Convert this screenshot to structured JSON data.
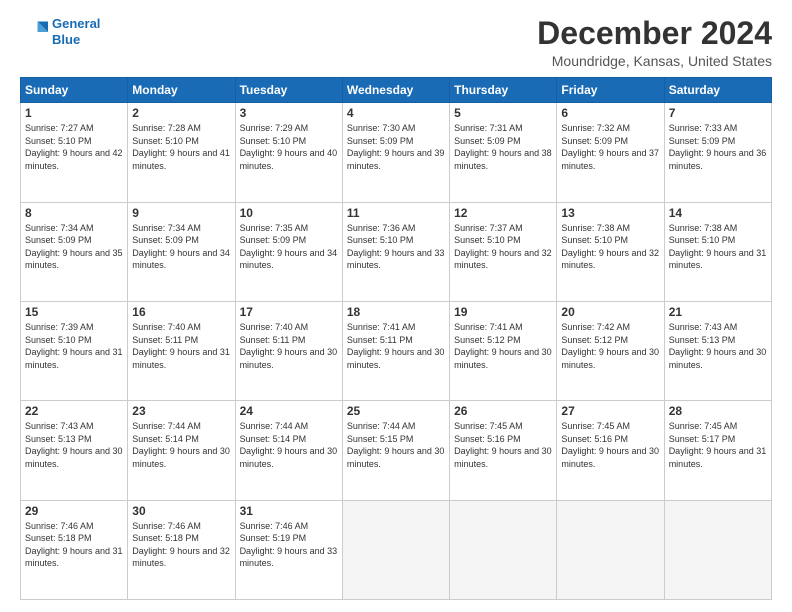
{
  "header": {
    "logo_line1": "General",
    "logo_line2": "Blue",
    "month_title": "December 2024",
    "location": "Moundridge, Kansas, United States"
  },
  "weekdays": [
    "Sunday",
    "Monday",
    "Tuesday",
    "Wednesday",
    "Thursday",
    "Friday",
    "Saturday"
  ],
  "weeks": [
    [
      {
        "day": "1",
        "sunrise": "7:27 AM",
        "sunset": "5:10 PM",
        "daylight": "9 hours and 42 minutes."
      },
      {
        "day": "2",
        "sunrise": "7:28 AM",
        "sunset": "5:10 PM",
        "daylight": "9 hours and 41 minutes."
      },
      {
        "day": "3",
        "sunrise": "7:29 AM",
        "sunset": "5:10 PM",
        "daylight": "9 hours and 40 minutes."
      },
      {
        "day": "4",
        "sunrise": "7:30 AM",
        "sunset": "5:09 PM",
        "daylight": "9 hours and 39 minutes."
      },
      {
        "day": "5",
        "sunrise": "7:31 AM",
        "sunset": "5:09 PM",
        "daylight": "9 hours and 38 minutes."
      },
      {
        "day": "6",
        "sunrise": "7:32 AM",
        "sunset": "5:09 PM",
        "daylight": "9 hours and 37 minutes."
      },
      {
        "day": "7",
        "sunrise": "7:33 AM",
        "sunset": "5:09 PM",
        "daylight": "9 hours and 36 minutes."
      }
    ],
    [
      {
        "day": "8",
        "sunrise": "7:34 AM",
        "sunset": "5:09 PM",
        "daylight": "9 hours and 35 minutes."
      },
      {
        "day": "9",
        "sunrise": "7:34 AM",
        "sunset": "5:09 PM",
        "daylight": "9 hours and 34 minutes."
      },
      {
        "day": "10",
        "sunrise": "7:35 AM",
        "sunset": "5:09 PM",
        "daylight": "9 hours and 34 minutes."
      },
      {
        "day": "11",
        "sunrise": "7:36 AM",
        "sunset": "5:10 PM",
        "daylight": "9 hours and 33 minutes."
      },
      {
        "day": "12",
        "sunrise": "7:37 AM",
        "sunset": "5:10 PM",
        "daylight": "9 hours and 32 minutes."
      },
      {
        "day": "13",
        "sunrise": "7:38 AM",
        "sunset": "5:10 PM",
        "daylight": "9 hours and 32 minutes."
      },
      {
        "day": "14",
        "sunrise": "7:38 AM",
        "sunset": "5:10 PM",
        "daylight": "9 hours and 31 minutes."
      }
    ],
    [
      {
        "day": "15",
        "sunrise": "7:39 AM",
        "sunset": "5:10 PM",
        "daylight": "9 hours and 31 minutes."
      },
      {
        "day": "16",
        "sunrise": "7:40 AM",
        "sunset": "5:11 PM",
        "daylight": "9 hours and 31 minutes."
      },
      {
        "day": "17",
        "sunrise": "7:40 AM",
        "sunset": "5:11 PM",
        "daylight": "9 hours and 30 minutes."
      },
      {
        "day": "18",
        "sunrise": "7:41 AM",
        "sunset": "5:11 PM",
        "daylight": "9 hours and 30 minutes."
      },
      {
        "day": "19",
        "sunrise": "7:41 AM",
        "sunset": "5:12 PM",
        "daylight": "9 hours and 30 minutes."
      },
      {
        "day": "20",
        "sunrise": "7:42 AM",
        "sunset": "5:12 PM",
        "daylight": "9 hours and 30 minutes."
      },
      {
        "day": "21",
        "sunrise": "7:43 AM",
        "sunset": "5:13 PM",
        "daylight": "9 hours and 30 minutes."
      }
    ],
    [
      {
        "day": "22",
        "sunrise": "7:43 AM",
        "sunset": "5:13 PM",
        "daylight": "9 hours and 30 minutes."
      },
      {
        "day": "23",
        "sunrise": "7:44 AM",
        "sunset": "5:14 PM",
        "daylight": "9 hours and 30 minutes."
      },
      {
        "day": "24",
        "sunrise": "7:44 AM",
        "sunset": "5:14 PM",
        "daylight": "9 hours and 30 minutes."
      },
      {
        "day": "25",
        "sunrise": "7:44 AM",
        "sunset": "5:15 PM",
        "daylight": "9 hours and 30 minutes."
      },
      {
        "day": "26",
        "sunrise": "7:45 AM",
        "sunset": "5:16 PM",
        "daylight": "9 hours and 30 minutes."
      },
      {
        "day": "27",
        "sunrise": "7:45 AM",
        "sunset": "5:16 PM",
        "daylight": "9 hours and 30 minutes."
      },
      {
        "day": "28",
        "sunrise": "7:45 AM",
        "sunset": "5:17 PM",
        "daylight": "9 hours and 31 minutes."
      }
    ],
    [
      {
        "day": "29",
        "sunrise": "7:46 AM",
        "sunset": "5:18 PM",
        "daylight": "9 hours and 31 minutes."
      },
      {
        "day": "30",
        "sunrise": "7:46 AM",
        "sunset": "5:18 PM",
        "daylight": "9 hours and 32 minutes."
      },
      {
        "day": "31",
        "sunrise": "7:46 AM",
        "sunset": "5:19 PM",
        "daylight": "9 hours and 33 minutes."
      },
      null,
      null,
      null,
      null
    ]
  ]
}
